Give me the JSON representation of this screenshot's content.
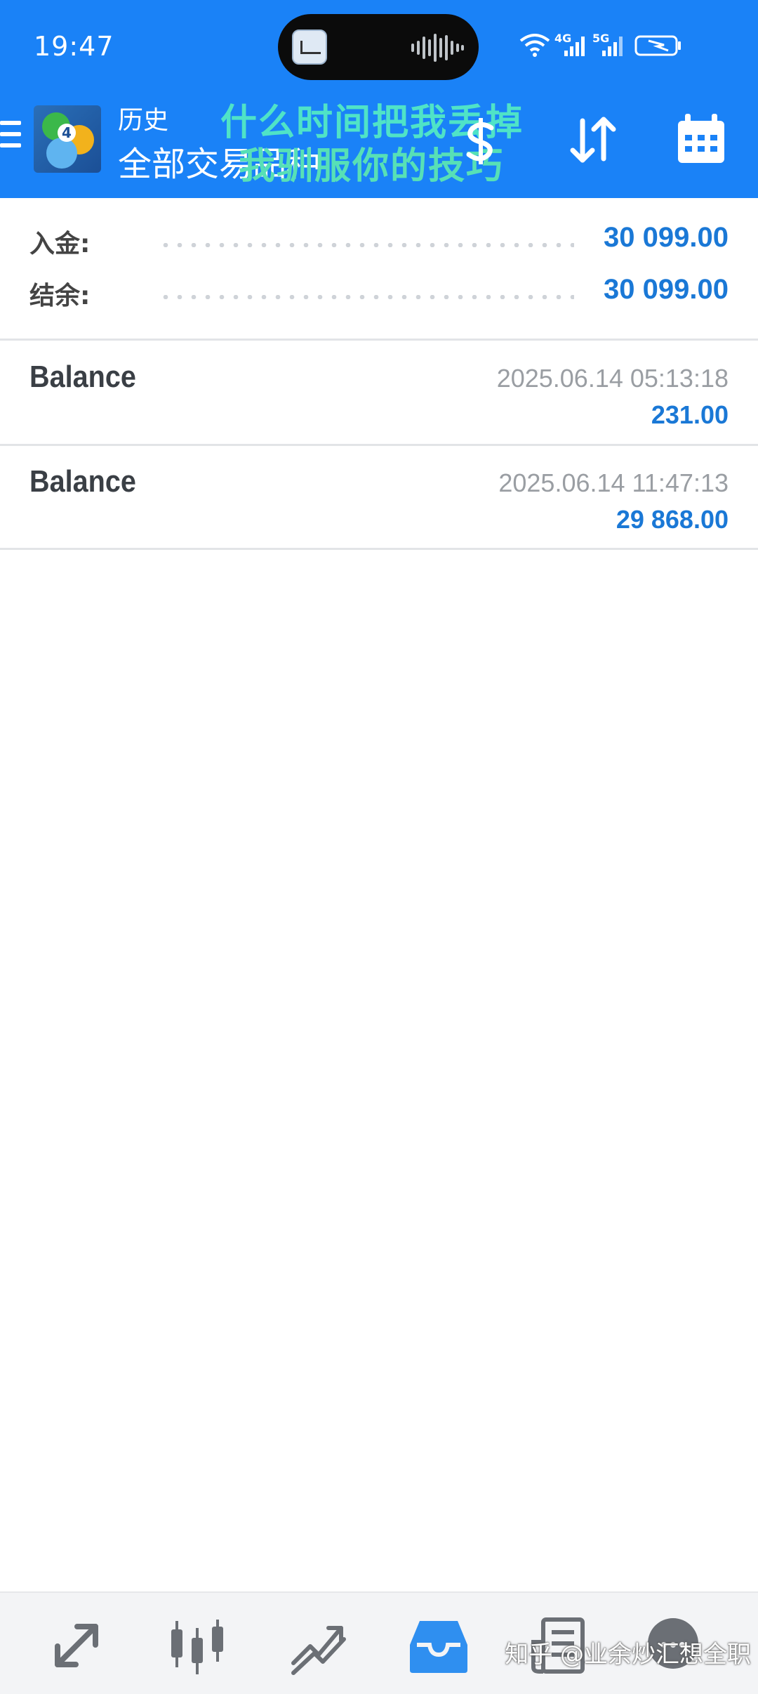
{
  "status_bar": {
    "time": "19:47",
    "network_labels": [
      "4G",
      "5G"
    ]
  },
  "header": {
    "title": "历史",
    "subtitle": "全部交易品种",
    "overlay_line1": "什么时间把我丢掉",
    "overlay_line2": "我驯服你的技巧"
  },
  "summary": [
    {
      "label": "入金:",
      "value": "30 099.00"
    },
    {
      "label": "结余:",
      "value": "30 099.00"
    }
  ],
  "deals": [
    {
      "type": "Balance",
      "date": "2025.06.14 05:13:18",
      "amount": "231.00"
    },
    {
      "type": "Balance",
      "date": "2025.06.14 11:47:13",
      "amount": "29 868.00"
    }
  ],
  "bottom_nav": {
    "items": [
      "quotes-icon",
      "charts-icon",
      "trade-icon",
      "history-icon",
      "news-icon",
      "chat-icon"
    ],
    "active_index": 3
  },
  "watermark": "知乎 @业余炒汇想全职",
  "colors": {
    "header_bg": "#1a82f7",
    "accent_value": "#1a78d6",
    "active_nav": "#2f8ff0",
    "inactive_nav": "#6b6f75"
  }
}
